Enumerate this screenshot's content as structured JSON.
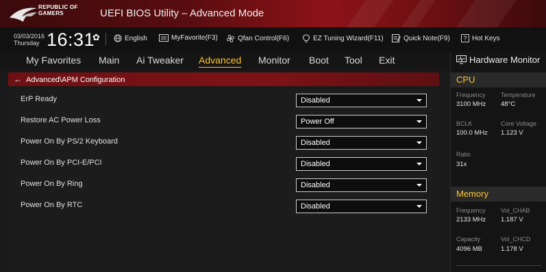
{
  "app": {
    "brand_line1": "REPUBLIC OF",
    "brand_line2": "GAMERS",
    "title": "UEFI BIOS Utility – Advanced Mode"
  },
  "infobar": {
    "date": "03/03/2016",
    "day": "Thursday",
    "time": "16:31",
    "items": [
      {
        "label": "English",
        "icon": "globe-icon"
      },
      {
        "label": "MyFavorite(F3)",
        "icon": "favorites-icon"
      },
      {
        "label": "Qfan Control(F6)",
        "icon": "fan-icon"
      },
      {
        "label": "EZ Tuning Wizard(F11)",
        "icon": "bulb-icon"
      },
      {
        "label": "Quick Note(F9)",
        "icon": "note-icon"
      },
      {
        "label": "Hot Keys",
        "icon": "hotkeys-icon"
      }
    ]
  },
  "menu": {
    "items": [
      "My Favorites",
      "Main",
      "Ai Tweaker",
      "Advanced",
      "Monitor",
      "Boot",
      "Tool",
      "Exit"
    ],
    "active": "Advanced"
  },
  "breadcrumb": "Advanced\\APM Configuration",
  "settings": [
    {
      "label": "ErP Ready",
      "value": "Disabled"
    },
    {
      "label": "Restore AC Power Loss",
      "value": "Power Off"
    },
    {
      "label": "Power On By PS/2 Keyboard",
      "value": "Disabled"
    },
    {
      "label": "Power On By PCI-E/PCI",
      "value": "Disabled"
    },
    {
      "label": "Power On By Ring",
      "value": "Disabled"
    },
    {
      "label": "Power On By RTC",
      "value": "Disabled"
    }
  ],
  "hardware_monitor": {
    "title": "Hardware Monitor",
    "cpu": {
      "section": "CPU",
      "frequency_label": "Frequency",
      "frequency_value": "3100 MHz",
      "temperature_label": "Temperature",
      "temperature_value": "48°C",
      "bclk_label": "BCLK",
      "bclk_value": "100.0 MHz",
      "core_voltage_label": "Core Voltage",
      "core_voltage_value": "1.123 V",
      "ratio_label": "Ratio",
      "ratio_value": "31x"
    },
    "memory": {
      "section": "Memory",
      "frequency_label": "Frequency",
      "frequency_value": "2133 MHz",
      "vol_chab_label": "Vol_CHAB",
      "vol_chab_value": "1.187 V",
      "capacity_label": "Capacity",
      "capacity_value": "4096 MB",
      "vol_chcd_label": "Vol_CHCD",
      "vol_chcd_value": "1.178 V"
    }
  },
  "colors": {
    "accent": "#ffc530",
    "title_red": "#8d1318",
    "breadcrumb_red": "#7d1216"
  }
}
